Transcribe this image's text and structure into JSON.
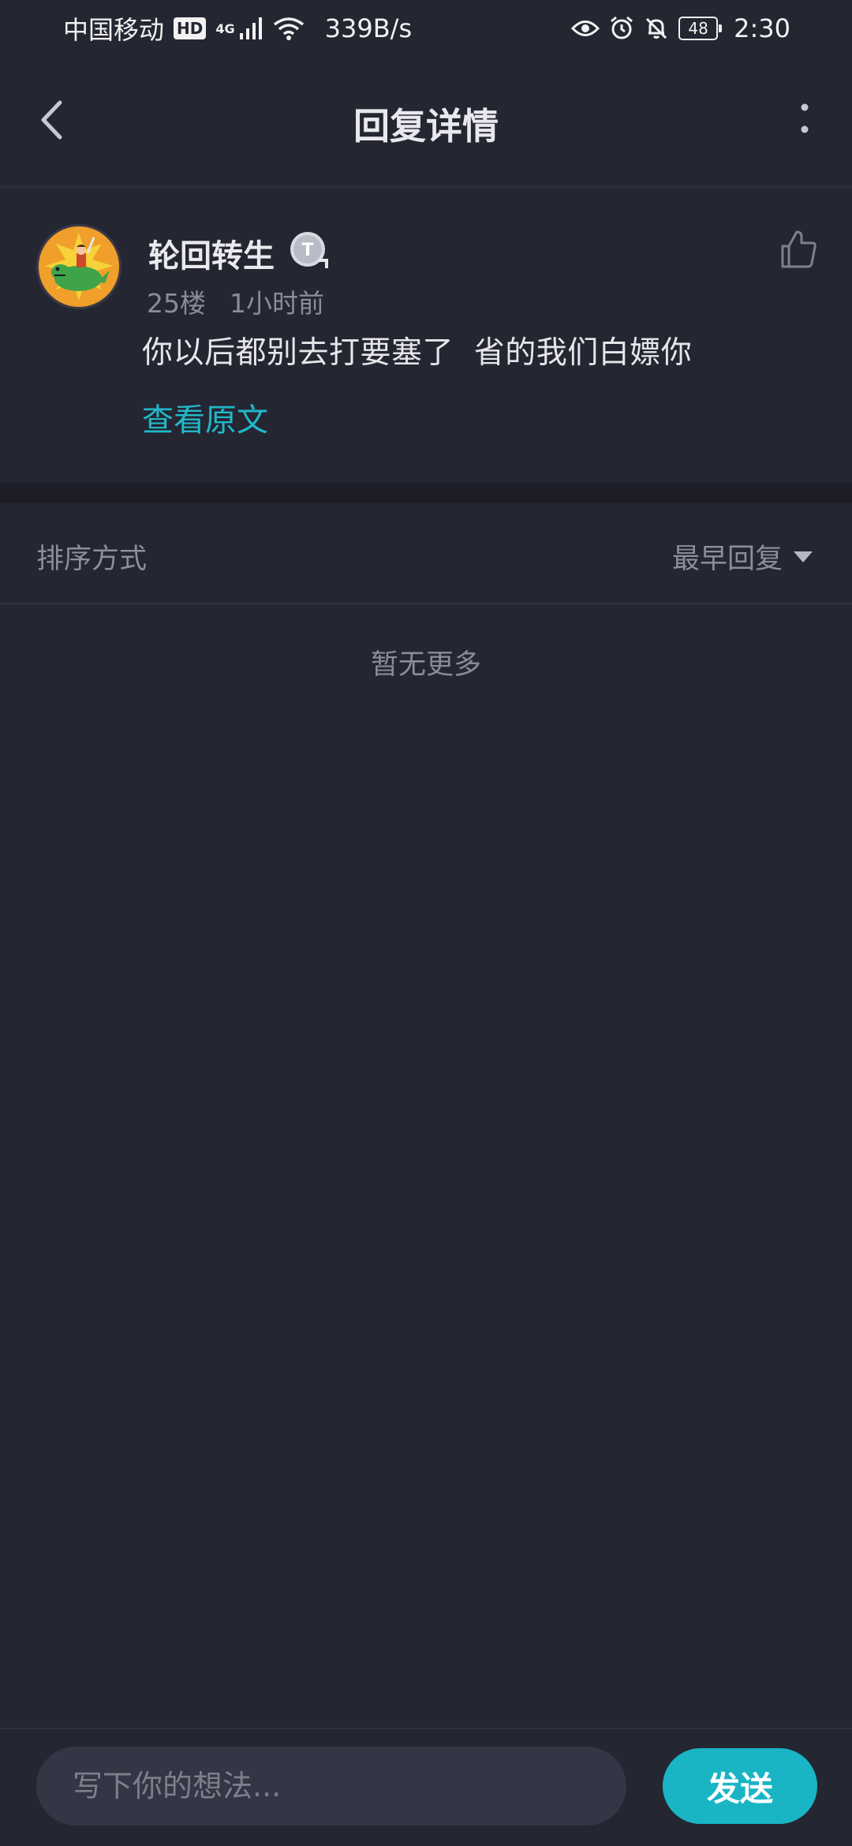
{
  "status_bar": {
    "carrier": "中国移动",
    "hd": "HD",
    "network": "4G",
    "speed": "339B/s",
    "battery": "48",
    "time": "2:30"
  },
  "header": {
    "title": "回复详情"
  },
  "comment": {
    "username": "轮回转生",
    "badge_letter": "T",
    "floor": "25楼",
    "time_ago": "1小时前",
    "text": "你以后都别去打要塞了  省的我们白嫖你",
    "view_original": "查看原文"
  },
  "sort": {
    "label": "排序方式",
    "selected": "最早回复"
  },
  "empty_state": "暂无更多",
  "composer": {
    "placeholder": "写下你的想法...",
    "send_label": "发送"
  },
  "colors": {
    "background": "#242632",
    "accent": "#19b5c4",
    "link": "#22b8c9",
    "muted_text": "#8a8c98"
  }
}
